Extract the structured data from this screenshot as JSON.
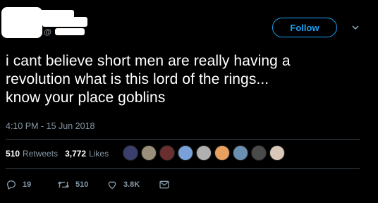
{
  "user": {
    "handle_prefix": "@"
  },
  "follow_button": {
    "label": "Follow"
  },
  "tweet": {
    "text_lines": [
      "i cant believe short men are really having a",
      "revolution what is this lord of the rings...",
      "know your place goblins"
    ],
    "timestamp": "4:10 PM - 15 Jun 2018"
  },
  "stats": {
    "retweets_count": "510",
    "retweets_label": "Retweets",
    "likes_count": "3,772",
    "likes_label": "Likes"
  },
  "liker_avatars": [
    {
      "name": "liker-avatar-1",
      "color": "#3a3f6b"
    },
    {
      "name": "liker-avatar-2",
      "color": "#9a8f7a"
    },
    {
      "name": "liker-avatar-3",
      "color": "#6b2e2e"
    },
    {
      "name": "liker-avatar-4",
      "color": "#7aa0d8"
    },
    {
      "name": "liker-avatar-5",
      "color": "#b0b0b0"
    },
    {
      "name": "liker-avatar-6",
      "color": "#e8a060"
    },
    {
      "name": "liker-avatar-7",
      "color": "#6a8fb0"
    },
    {
      "name": "liker-avatar-8",
      "color": "#4a4a4a"
    },
    {
      "name": "liker-avatar-9",
      "color": "#d9c8b8"
    }
  ],
  "actions": {
    "reply_count": "19",
    "retweet_count": "510",
    "like_count": "3.8K"
  },
  "colors": {
    "accent": "#1da1f2",
    "muted": "#8899a6",
    "divider": "#38444d",
    "background": "#000000"
  },
  "icons": [
    "reply-icon",
    "retweet-icon",
    "like-icon",
    "direct-message-icon",
    "chevron-down-icon"
  ]
}
